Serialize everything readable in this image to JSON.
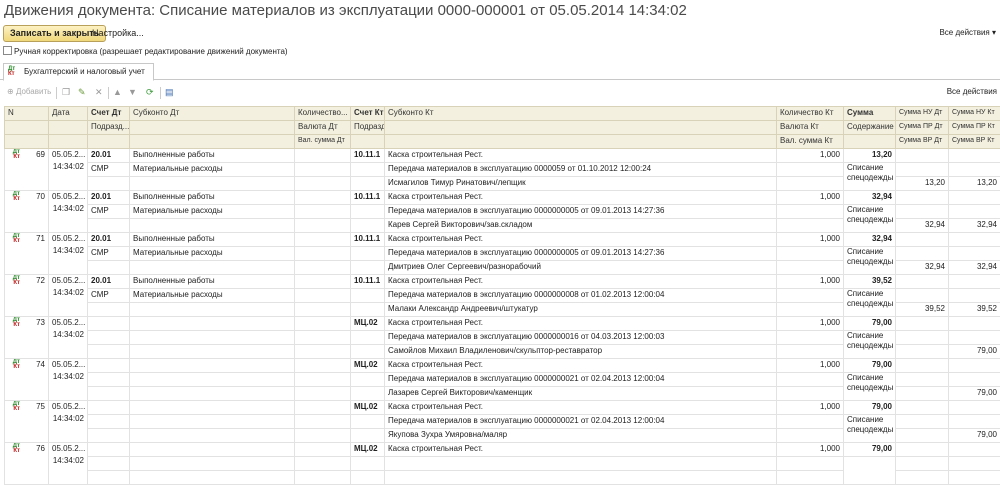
{
  "window": {
    "title": "Движения документа: Списание материалов из эксплуатации 0000-000001 от 05.05.2014 14:34:02"
  },
  "toolbar": {
    "save_close": "Записать и закрыть",
    "settings": "Настройка...",
    "all_actions": "Все действия ▾"
  },
  "manual": {
    "label": "Ручная корректировка (разрешает редактирование движений документа)"
  },
  "tab": {
    "label": "Бухгалтерский и налоговый учет"
  },
  "gridbar": {
    "add": "Добавить",
    "all_actions": "Все действия"
  },
  "headers": {
    "n": "N",
    "date": "Дата",
    "acc_dt": "Счет Дт",
    "subk_dt": "Субконто Дт",
    "qty_dt": "Количество...",
    "acc_kt": "Счет Кт",
    "subk_kt": "Субконто Кт",
    "qty_kt": "Количество Кт",
    "sum": "Сумма",
    "nu_dt": "Сумма НУ Дт",
    "nu_kt": "Сумма НУ Кт",
    "podr_dt": "Подразд...",
    "cur_dt": "Валюта Дт",
    "podr_kt": "Подразд...",
    "cur_kt": "Валюта Кт",
    "content": "Содержание",
    "pr_dt": "Сумма ПР Дт",
    "pr_kt": "Сумма ПР Кт",
    "valsum_dt": "Вал. сумма Дт",
    "valsum_kt": "Вал. сумма Кт",
    "vr_dt": "Сумма ВР Дт",
    "vr_kt": "Сумма ВР Кт"
  },
  "rows": [
    {
      "n": "69",
      "date": "05.05.2...",
      "time": "14:34:02",
      "acc_dt": "20.01",
      "podr_dt": "СМР",
      "subk_dt1": "Выполненные работы",
      "subk_dt2": "Материальные расходы",
      "acc_kt": "10.11.1",
      "subk_kt1": "Каска строительная Рест.",
      "subk_kt2": "Передача материалов в эксплуатацию 0000059 от 01.10.2012 12:00:24",
      "subk_kt3": "Исмагилов Тимур Ринатович/лепщик",
      "qty_kt": "1,000",
      "sum": "13,20",
      "content": "Списание спецодежды",
      "nu_dt": "",
      "nu_kt": "",
      "vr_dt": "13,20",
      "vr_kt": "13,20"
    },
    {
      "n": "70",
      "date": "05.05.2...",
      "time": "14:34:02",
      "acc_dt": "20.01",
      "podr_dt": "СМР",
      "subk_dt1": "Выполненные работы",
      "subk_dt2": "Материальные расходы",
      "acc_kt": "10.11.1",
      "subk_kt1": "Каска строительная Рест.",
      "subk_kt2": "Передача материалов в эксплуатацию 0000000005 от 09.01.2013 14:27:36",
      "subk_kt3": "Карев Сергей Викторович/зав.складом",
      "qty_kt": "1,000",
      "sum": "32,94",
      "content": "Списание спецодежды",
      "nu_dt": "",
      "nu_kt": "",
      "vr_dt": "32,94",
      "vr_kt": "32,94"
    },
    {
      "n": "71",
      "date": "05.05.2...",
      "time": "14:34:02",
      "acc_dt": "20.01",
      "podr_dt": "СМР",
      "subk_dt1": "Выполненные работы",
      "subk_dt2": "Материальные расходы",
      "acc_kt": "10.11.1",
      "subk_kt1": "Каска строительная Рест.",
      "subk_kt2": "Передача материалов в эксплуатацию 0000000005 от 09.01.2013 14:27:36",
      "subk_kt3": "Дмитриев Олег Сергеевич/разнорабочий",
      "qty_kt": "1,000",
      "sum": "32,94",
      "content": "Списание спецодежды",
      "nu_dt": "",
      "nu_kt": "",
      "vr_dt": "32,94",
      "vr_kt": "32,94"
    },
    {
      "n": "72",
      "date": "05.05.2...",
      "time": "14:34:02",
      "acc_dt": "20.01",
      "podr_dt": "СМР",
      "subk_dt1": "Выполненные работы",
      "subk_dt2": "Материальные расходы",
      "acc_kt": "10.11.1",
      "subk_kt1": "Каска строительная Рест.",
      "subk_kt2": "Передача материалов в эксплуатацию 0000000008 от 01.02.2013 12:00:04",
      "subk_kt3": "Малаки Александр Андреевич/штукатур",
      "qty_kt": "1,000",
      "sum": "39,52",
      "content": "Списание спецодежды",
      "nu_dt": "",
      "nu_kt": "",
      "vr_dt": "39,52",
      "vr_kt": "39,52"
    },
    {
      "n": "73",
      "date": "05.05.2...",
      "time": "14:34:02",
      "acc_dt": "",
      "podr_dt": "",
      "subk_dt1": "",
      "subk_dt2": "",
      "acc_kt": "МЦ.02",
      "subk_kt1": "Каска строительная Рест.",
      "subk_kt2": "Передача материалов в эксплуатацию 0000000016 от 04.03.2013 12:00:03",
      "subk_kt3": "Самойлов Михаил Владиленович/скульптор-реставратор",
      "qty_kt": "1,000",
      "sum": "79,00",
      "content": "Списание спецодежды",
      "nu_dt": "",
      "nu_kt": "",
      "vr_dt": "",
      "vr_kt": "79,00"
    },
    {
      "n": "74",
      "date": "05.05.2...",
      "time": "14:34:02",
      "acc_dt": "",
      "podr_dt": "",
      "subk_dt1": "",
      "subk_dt2": "",
      "acc_kt": "МЦ.02",
      "subk_kt1": "Каска строительная Рест.",
      "subk_kt2": "Передача материалов в эксплуатацию 0000000021 от 02.04.2013 12:00:04",
      "subk_kt3": "Лазарев Сергей Викторович/каменщик",
      "qty_kt": "1,000",
      "sum": "79,00",
      "content": "Списание спецодежды",
      "nu_dt": "",
      "nu_kt": "",
      "vr_dt": "",
      "vr_kt": "79,00"
    },
    {
      "n": "75",
      "date": "05.05.2...",
      "time": "14:34:02",
      "acc_dt": "",
      "podr_dt": "",
      "subk_dt1": "",
      "subk_dt2": "",
      "acc_kt": "МЦ.02",
      "subk_kt1": "Каска строительная Рест.",
      "subk_kt2": "Передача материалов в эксплуатацию 0000000021 от 02.04.2013 12:00:04",
      "subk_kt3": "Якупова Зухра Умяровна/маляр",
      "qty_kt": "1,000",
      "sum": "79,00",
      "content": "Списание спецодежды",
      "nu_dt": "",
      "nu_kt": "",
      "vr_dt": "",
      "vr_kt": "79,00"
    },
    {
      "n": "76",
      "date": "05.05.2...",
      "time": "14:34:02",
      "acc_dt": "",
      "podr_dt": "",
      "subk_dt1": "",
      "subk_dt2": "",
      "acc_kt": "МЦ.02",
      "subk_kt1": "Каска строительная Рест.",
      "subk_kt2": "",
      "subk_kt3": "",
      "qty_kt": "1,000",
      "sum": "79,00",
      "content": "",
      "nu_dt": "",
      "nu_kt": "",
      "vr_dt": "",
      "vr_kt": ""
    }
  ]
}
